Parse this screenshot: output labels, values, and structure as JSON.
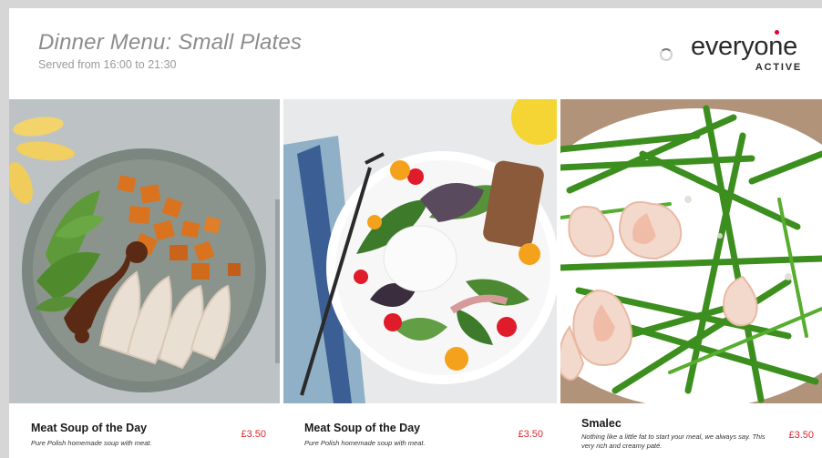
{
  "header": {
    "title": "Dinner Menu: Small Plates",
    "subtitle": "Served from 16:00 to 21:30"
  },
  "logo": {
    "word": "everyone",
    "sub": "ACTIVE"
  },
  "colors": {
    "price": "#e0262d",
    "logo_dot": "#e4002b",
    "title": "#8c8c8c"
  },
  "menu_items": [
    {
      "name": "Meat Soup of the Day",
      "description": "Pure Polish homemade soup with meat.",
      "price": "£3.50",
      "photo": "roast-chicken-sweet-potato-plate"
    },
    {
      "name": "Meat Soup of the Day",
      "description": "Pure Polish homemade soup with meat.",
      "price": "£3.50",
      "photo": "poached-egg-salad-bowl"
    },
    {
      "name": "Smalec",
      "description": "Nothing like a little fat to start your meal, we always say. This very rich and creamy paté.",
      "price": "£3.50",
      "photo": "prawn-asparagus-plate"
    }
  ]
}
